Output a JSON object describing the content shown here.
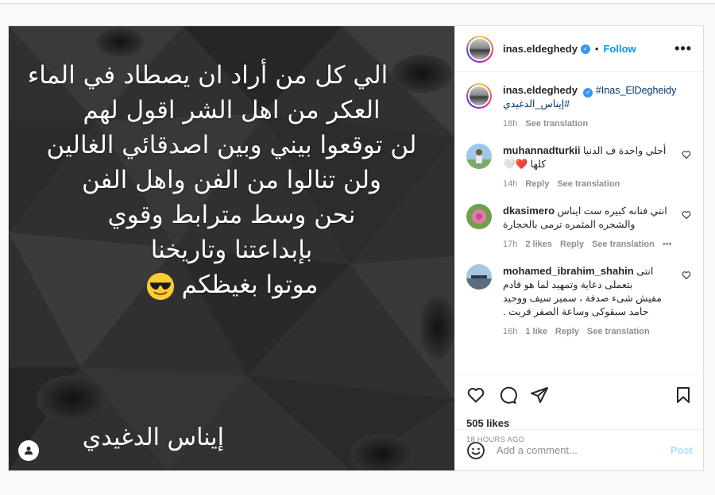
{
  "header": {
    "username": "inas.eldeghedy",
    "separator": "•",
    "follow_label": "Follow",
    "more_label": "•••"
  },
  "image": {
    "lines": [
      "الي كل من أراد ان يصطاد في الماء",
      "العكر من اهل الشر اقول لهم",
      "لن توقعوا بيني وبين اصدقائي الغالين",
      "ولن تنالوا من الفن واهل الفن",
      "نحن وسط مترابط وقوي",
      "بإبداعتنا وتاريخنا",
      "موتوا بغيظكم"
    ],
    "signature": "إيناس الدغيدي",
    "emoji": "smiling-face-with-sunglasses"
  },
  "caption": {
    "username": "inas.eldeghedy",
    "hashtag1": "#Inas_ElDegheidy",
    "hashtag2": "#إيناس_الدغيدي",
    "time": "18h",
    "translate": "See translation"
  },
  "comments": [
    {
      "username": "muhannadturkii",
      "text_line1": "أحلي واحدة ف الدنيا",
      "text_line2": "كلها ❤️🤍",
      "time": "14h",
      "reply": "Reply",
      "translate": "See translation"
    },
    {
      "username": "dkasimero",
      "text_line1": "انتي فنانه كبيره ست ايناس",
      "text_line2": "والشجره المثمره ترمى بالحجارة",
      "time": "17h",
      "likes": "2 likes",
      "reply": "Reply",
      "translate": "See translation",
      "more": "•••"
    },
    {
      "username": "mohamed_ibrahim_shahin",
      "text_line1": "انتى",
      "text_line2": "بتعملى دعاية وتمهيد لما هو قادم",
      "text_line3": "مفيش شىء صدفة ، سمير سيف ووحيد",
      "text_line4": "حامد سبقوكى وساعة الصفر قربت .",
      "time": "16h",
      "likes": "1 like",
      "reply": "Reply",
      "translate": "See translation"
    }
  ],
  "stats": {
    "likes": "505 likes",
    "ago": "18 HOURS AGO"
  },
  "add_comment": {
    "placeholder": "Add a comment...",
    "post_label": "Post"
  },
  "colors": {
    "follow": "#0095f6",
    "verified": "#3897f0",
    "post_disabled": "#b3dbff",
    "heart_red": "#ed4956"
  }
}
